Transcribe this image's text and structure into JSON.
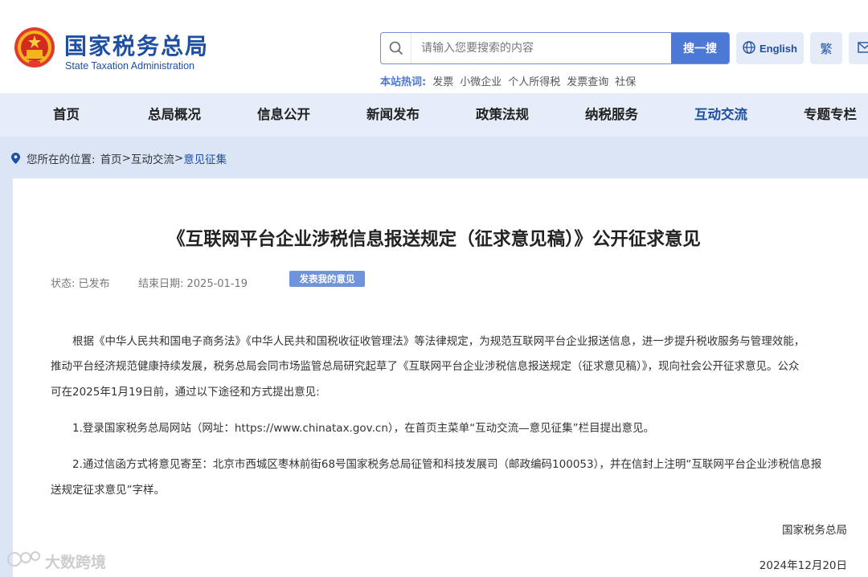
{
  "header": {
    "site_name": "国家税务总局",
    "site_name_en": "State Taxation Administration",
    "search": {
      "placeholder": "请输入您要搜索的内容",
      "button": "搜一搜"
    },
    "english_label": "English",
    "traditional_label": "繁",
    "hot": {
      "label": "本站热词:",
      "items": [
        "发票",
        "小微企业",
        "个人所得税",
        "发票查询",
        "社保"
      ]
    }
  },
  "nav": {
    "items": [
      "首页",
      "总局概况",
      "信息公开",
      "新闻发布",
      "政策法规",
      "纳税服务",
      "互动交流",
      "专题专栏"
    ],
    "active": "互动交流"
  },
  "breadcrumb": {
    "label": "您所在的位置:",
    "home": "首页",
    "sep1": ">",
    "section": "互动交流",
    "sep2": ">",
    "current": "意见征集"
  },
  "article": {
    "title": "《互联网平台企业涉税信息报送规定（征求意见稿）》公开征求意见",
    "status": "状态:  已发布",
    "end_date": "结束日期:  2025-01-19",
    "comment_button": "发表我的意见",
    "para1_line1": "根据《中华人民共和国电子商务法》《中华人民共和国税收征收管理法》等法律规定，为规范互联网平台企业报送信息，进一步提升税收服务与管理效能，",
    "para1_line2": "推动平台经济规范健康持续发展，税务总局会同市场监管总局研究起草了《互联网平台企业涉税信息报送规定（征求意见稿）》，现向社会公开征求意见。公众",
    "para1_line3": "可在2025年1月19日前，通过以下途径和方式提出意见:",
    "item1": "1.登录国家税务总局网站（网址：https://www.chinatax.gov.cn），在首页主菜单“互动交流—意见征集”栏目提出意见。",
    "item2_line1": "2.通过信函方式将意见寄至：北京市西城区枣林前街68号国家税务总局征管和科技发展司（邮政编码100053），并在信封上注明“互联网平台企业涉税信息报",
    "item2_line2": "送规定征求意见”字样。",
    "signature": "国家税务总局",
    "date": "2024年12月20日"
  },
  "watermark": "大数跨境",
  "colors": {
    "brand": "#1f4fa3",
    "accent": "#4c78d6",
    "nav_bg": "#e6edf8",
    "crumb_bg": "#dbe5f5"
  }
}
